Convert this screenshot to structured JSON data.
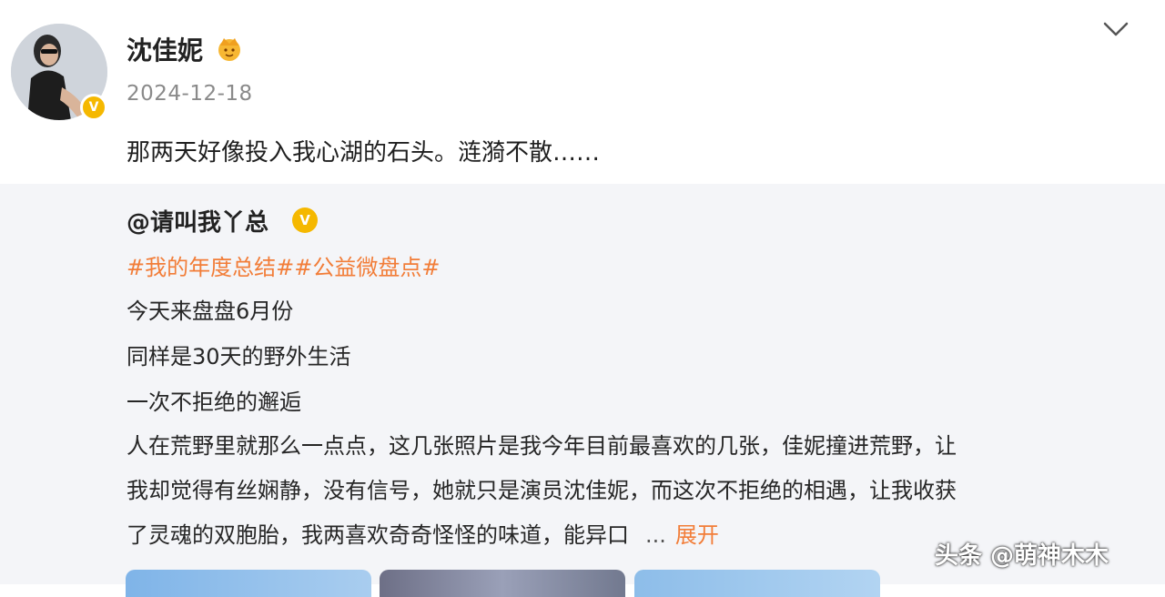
{
  "post": {
    "author": "沈佳妮",
    "date": "2024-12-18",
    "text": "那两天好像投入我心湖的石头。涟漪不散……"
  },
  "repost": {
    "author": "@请叫我丫总",
    "hashtags": "#我的年度总结##公益微盘点#",
    "lines": [
      "今天来盘盘6月份",
      "同样是30天的野外生活",
      "一次不拒绝的邂逅",
      "人在荒野里就那么一点点，这几张照片是我今年目前最喜欢的几张，佳妮撞进荒野，让",
      "我却觉得有丝娴静，没有信号，她就只是演员沈佳妮，而这次不拒绝的相遇，让我收获",
      "了灵魂的双胞胎，我两喜欢奇奇怪怪的味道，能异口"
    ],
    "ellipsis": "...",
    "expand_label": "展开"
  },
  "icons": {
    "verified": "verified-badge-icon",
    "crown": "crown-icon",
    "chevron": "chevron-down-icon"
  },
  "colors": {
    "link": "#f27d38",
    "verified": "#f5b800",
    "repost_bg": "#f4f5f8"
  },
  "watermark": "头条 @萌神木木"
}
